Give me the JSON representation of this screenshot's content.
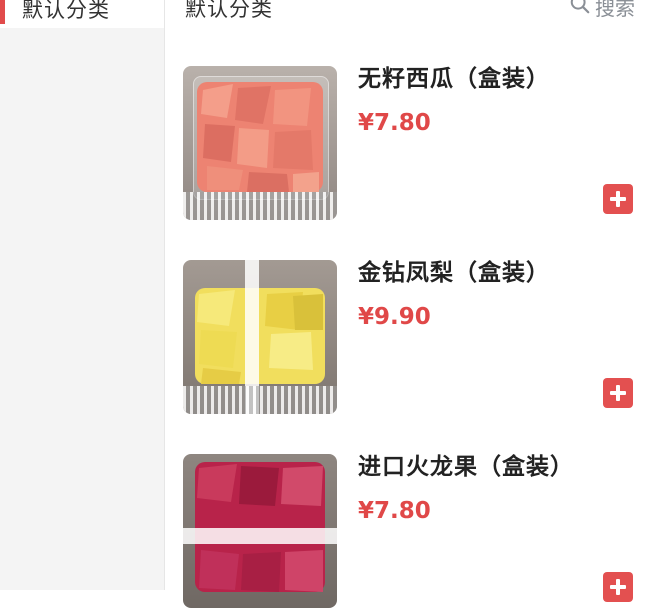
{
  "sidebar": {
    "items": [
      {
        "label": "默认分类",
        "active": true
      }
    ],
    "accent_color": "#e14b4b"
  },
  "main": {
    "title": "默认分类",
    "search": {
      "label": "搜索",
      "icon": "search-icon"
    },
    "products": [
      {
        "name": "无籽西瓜（盒装）",
        "price": "¥7.80",
        "image": "watermelon-box",
        "add_icon": "plus-icon"
      },
      {
        "name": "金钻凤梨（盒装）",
        "price": "¥9.90",
        "image": "pineapple-box",
        "add_icon": "plus-icon"
      },
      {
        "name": "进口火龙果（盒装）",
        "price": "¥7.80",
        "image": "dragonfruit-box",
        "add_icon": "plus-icon"
      }
    ]
  },
  "colors": {
    "price": "#e04848",
    "add_button": "#e35050",
    "sidebar_bg": "#f4f4f4"
  }
}
